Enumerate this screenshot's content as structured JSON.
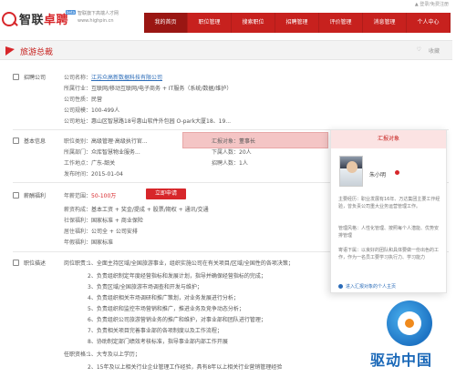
{
  "topstrip": {
    "login": "▲ 登录/免费注册"
  },
  "brand": {
    "name_a": "智联",
    "name_b": "卓聘",
    "beta": "beta",
    "slogan_1": "智联旗下高端人才网",
    "slogan_2": "www.highpin.cn"
  },
  "nav": [
    "我的首页",
    "职位管理",
    "搜索职位",
    "招聘管理",
    "评价管理",
    "消息管理",
    "个人中心"
  ],
  "titlebar": {
    "title": "旅游总裁",
    "fav_icon": "♡",
    "fav": "收藏"
  },
  "company": {
    "label": "招聘公司",
    "rows": [
      {
        "k": "公司名称：",
        "v": "江苏众高新数据科技有限公司"
      },
      {
        "k": "所属行业：",
        "v": "互联网/移动互联网/电子商务 + IT服务（系统/数据/维护）"
      },
      {
        "k": "公司性质：",
        "v": "民营"
      },
      {
        "k": "公司规模：",
        "v": "100-499人"
      },
      {
        "k": "公司地址：",
        "v": "惠山区智慧路18号惠山软件外包园 O-park大厦18、19..."
      }
    ]
  },
  "basic": {
    "label": "基本信息",
    "rows": [
      {
        "k": "职位类别：",
        "v": "高级管理·高级执行官..."
      },
      {
        "k": "所属部门：",
        "v": "众库智慧物业服务..."
      },
      {
        "k": "工作地点：",
        "v": "广东-韶关"
      },
      {
        "k": "发布时间：",
        "v": "2015-01-04"
      }
    ],
    "right_rows": [
      {
        "k": "汇报对象：",
        "v": "董事长"
      },
      {
        "k": "下属人数：",
        "v": "20人"
      },
      {
        "k": "招聘人数：",
        "v": "1人"
      }
    ]
  },
  "salary": {
    "label": "薪酬福利",
    "rows": [
      {
        "k": "年薪范围：",
        "v": "50-100万"
      },
      {
        "k": "薪资构成：",
        "v": "基本工资 + 奖金/提成 + 股票/期权 + 通讯/交通"
      },
      {
        "k": "社保福利：",
        "v": "国家标准 + 商业保险"
      },
      {
        "k": "居住福利：",
        "v": "公司全 + 公司安排"
      },
      {
        "k": "年假福利：",
        "v": "国家标准"
      }
    ],
    "apply": "立即申请"
  },
  "report_box": {
    "text": "汇报对象：董事长"
  },
  "panel": {
    "head": "汇报对象",
    "name": "朱小明",
    "lines": [
      "主要经历：职业发展有16年、万达集团主要工作经验，曾负责公司重大业务运营管理工作。",
      "管理风格：人性化管理、按照每个人潜能、优势安排管理",
      "寄语下属：以良好的团队和具体要做一份出色的工作，作为一名员工要学习执行力、学习能力"
    ],
    "foot": "进入汇报对象的个人主页"
  },
  "duty": {
    "label": "职位描述",
    "heading": "岗位职责：",
    "lines": [
      "1、全面主持区域/全国旅游事业，组织实施公司在有关项目/区域/全国性的各项决策；",
      "2、负责组织制定年度经营指标和发展计划，指导并确保经营指标的完成；",
      "3、负责区域/全国旅游市场调查和开发与维护；",
      "4、负责组织相关市场调研和推广策划，对业务发展进行分析；",
      "5、负责组织和监控市场营销和推广，推进业务及竞争动态分析；",
      "6、负责组织公司旅游营销业务的推广和维护，对事业部和团队进行管理；",
      "7、负责相关项目完善事业部的各项制度以及工作流程；",
      "8、协助制定部门绩效考核标准，指导事业部内部工作开展"
    ],
    "req_heading": "任职资格：",
    "req_lines": [
      "1、大专及以上学历；",
      "2、15年及以上相关行业企业管理工作经验，具有8年以上相关行业营销管理经验"
    ]
  },
  "watermark": {
    "text": "驱动中国"
  }
}
